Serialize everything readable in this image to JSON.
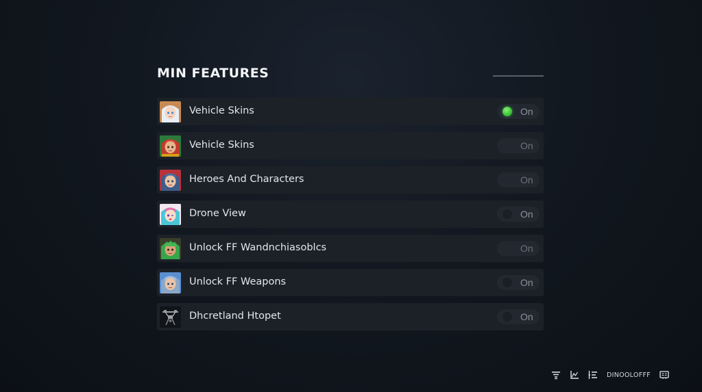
{
  "header": {
    "title": "MIN FEATURES"
  },
  "features": [
    {
      "label": "Vehicle Skins",
      "toggle_text": "On",
      "active": true,
      "avatar_icon": "anime-girl-white-hair-icon"
    },
    {
      "label": "Vehicle Skins",
      "toggle_text": "On",
      "active": false,
      "avatar_icon": "anime-girl-red-hair-icon"
    },
    {
      "label": "Heroes And Characters",
      "toggle_text": "On",
      "active": false,
      "avatar_icon": "anime-girl-blue-hair-icon"
    },
    {
      "label": "Drone View",
      "toggle_text": "On",
      "active": false,
      "avatar_icon": "anime-girl-cyan-hair-icon"
    },
    {
      "label": "Unlock FF Wandnchiasoblcs",
      "toggle_text": "On",
      "active": false,
      "avatar_icon": "character-green-hair-icon"
    },
    {
      "label": "Unlock FF Weapons",
      "toggle_text": "On",
      "active": false,
      "avatar_icon": "character-blue-hair-icon"
    },
    {
      "label": "Dhcretland Htopet",
      "toggle_text": "On",
      "active": false,
      "avatar_icon": "drone-icon"
    }
  ],
  "footer": {
    "icons": [
      "filter-icon",
      "chart-icon",
      "list-icon"
    ],
    "username": "DINOOLOFFF",
    "end_icon": "id-card-icon"
  },
  "colors": {
    "active_dot": "#3dc83a",
    "row_bg": "#1c2128",
    "background": "#121820"
  }
}
